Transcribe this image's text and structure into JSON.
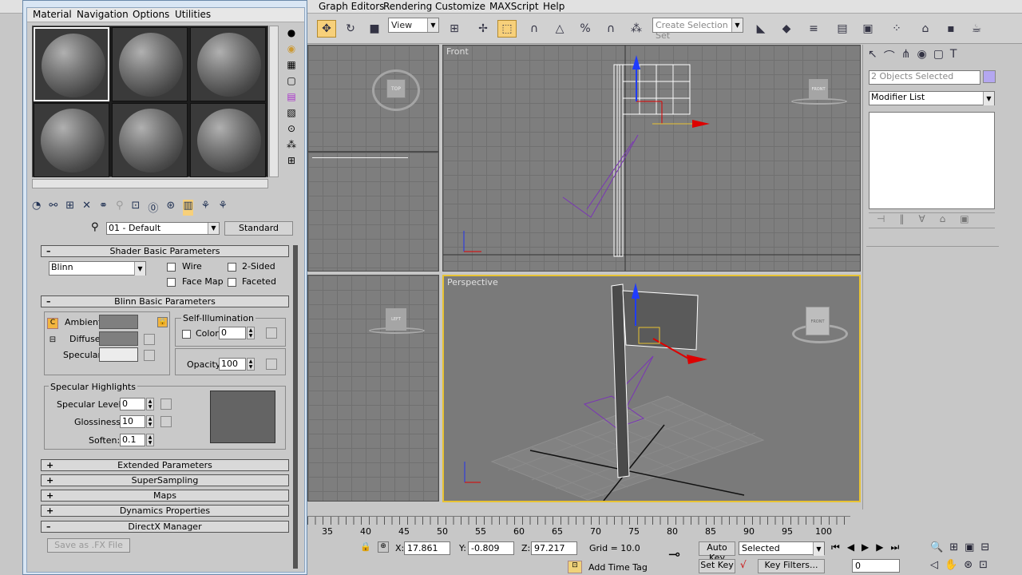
{
  "menubar": {
    "items": [
      "Graph Editors",
      "Rendering",
      "Customize",
      "MAXScript",
      "Help"
    ]
  },
  "toolbar": {
    "view_combo": "View",
    "selection_set_placeholder": "Create Selection Set"
  },
  "viewports": {
    "top_left_label": "",
    "front_label": "Front",
    "perspective_label": "Perspective",
    "viewcube": {
      "top": "TOP",
      "front": "FRONT",
      "left": "LEFT"
    }
  },
  "command_panel": {
    "selection_info": "2 Objects Selected",
    "modifier_list": "Modifier List"
  },
  "material_editor": {
    "menu": [
      "Material",
      "Navigation",
      "Options",
      "Utilities"
    ],
    "material_name": "01 - Default",
    "material_type": "Standard",
    "shader_rollout": {
      "title": "Shader Basic Parameters",
      "shader": "Blinn",
      "wire": "Wire",
      "two_sided": "2-Sided",
      "face_map": "Face Map",
      "faceted": "Faceted"
    },
    "blinn_rollout": {
      "title": "Blinn Basic Parameters",
      "self_illum_group": "Self-Illumination",
      "color_label": "Color",
      "color_value": "0",
      "ambient": "Ambient:",
      "diffuse": "Diffuse:",
      "specular": "Specular:",
      "opacity_label": "Opacity:",
      "opacity_value": "100",
      "ambient_lock_letter": "C"
    },
    "specular_highlights": {
      "title": "Specular Highlights",
      "level_label": "Specular Level:",
      "level_value": "0",
      "gloss_label": "Glossiness:",
      "gloss_value": "10",
      "soften_label": "Soften:",
      "soften_value": "0.1"
    },
    "collapsed_rollouts": [
      "Extended Parameters",
      "SuperSampling",
      "Maps",
      "Dynamics Properties"
    ],
    "directx_rollout": {
      "title": "DirectX Manager",
      "save_fx": "Save as .FX File"
    }
  },
  "timeline": {
    "ticks": [
      "35",
      "40",
      "45",
      "50",
      "55",
      "60",
      "65",
      "70",
      "75",
      "80",
      "85",
      "90",
      "95",
      "100"
    ],
    "x_label": "X:",
    "x_value": "17.861",
    "y_label": "Y:",
    "y_value": "-0.809",
    "z_label": "Z:",
    "z_value": "97.217",
    "grid": "Grid = 10.0",
    "auto_key": "Auto Key",
    "set_key": "Set Key",
    "key_mode": "Selected",
    "key_filters": "Key Filters...",
    "add_time_tag": "Add Time Tag",
    "frame": "0"
  }
}
